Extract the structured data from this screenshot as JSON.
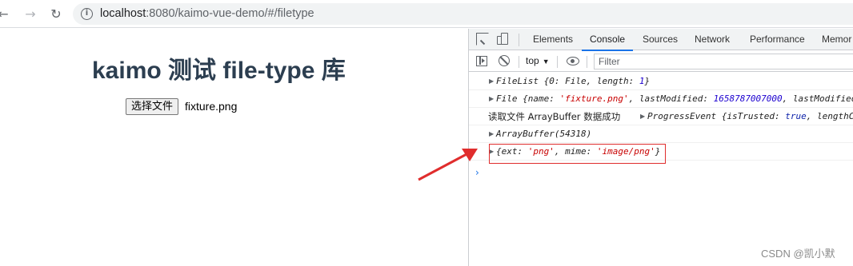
{
  "browser": {
    "url_host": "localhost",
    "url_path": ":8080/kaimo-vue-demo/#/filetype"
  },
  "page": {
    "title": "kaimo 测试 file-type 库",
    "file_button_label": "选择文件",
    "file_name": "fixture.png"
  },
  "devtools": {
    "tabs": [
      "Elements",
      "Console",
      "Sources",
      "Network",
      "Performance",
      "Memor"
    ],
    "active_tab": "Console",
    "context": "top",
    "filter_placeholder": "Filter"
  },
  "console": {
    "line1": {
      "name": "FileList",
      "key0": "0",
      "val0": "File",
      "key1": "length",
      "val1": "1"
    },
    "line2": {
      "name": "File",
      "key_name": "name",
      "val_name": "'fixture.png'",
      "key_lm": "lastModified",
      "val_lm": "1658787007000",
      "key_lm2": "lastModified"
    },
    "line3": {
      "prefix": "读取文件 ArrayBuffer 数据成功",
      "event": "ProgressEvent",
      "key_trusted": "isTrusted",
      "val_trusted": "true",
      "key_length": "lengthC"
    },
    "line4": {
      "text": "ArrayBuffer(54318)"
    },
    "line5": {
      "key_ext": "ext",
      "val_ext": "'png'",
      "key_mime": "mime",
      "val_mime": "'image/png'"
    }
  },
  "colors": {
    "accent": "#1a73e8",
    "annotation": "#e02d2d",
    "title": "#2c3e50"
  },
  "watermark": "CSDN @凯小默"
}
